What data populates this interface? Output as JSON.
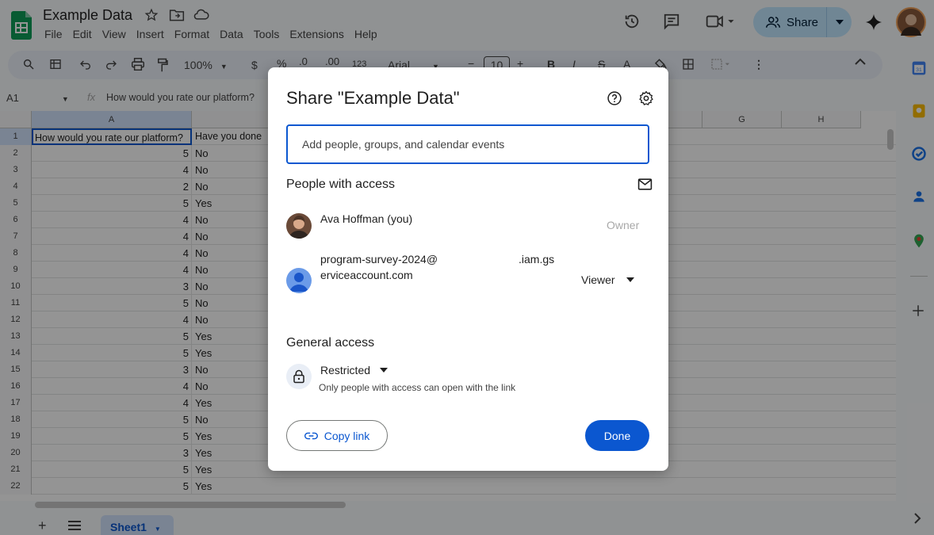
{
  "app": {
    "doc_title": "Example Data",
    "menu": [
      "File",
      "Edit",
      "View",
      "Insert",
      "Format",
      "Data",
      "Tools",
      "Extensions",
      "Help"
    ],
    "share_label": "Share"
  },
  "toolbar": {
    "zoom": "100%",
    "currency": "$",
    "percent": "%",
    "dec_decrease": ".0",
    "dec_increase": ".00",
    "number_format": "123",
    "font": "Arial",
    "font_size": "10"
  },
  "formula_bar": {
    "cell_ref": "A1",
    "content": "How would you rate our platform?"
  },
  "grid": {
    "columns": [
      "A",
      "G",
      "H"
    ],
    "header_a": "How would you rate our platform?",
    "header_b": "Have you done",
    "rows": [
      {
        "n": "2",
        "a": "5",
        "b": "No"
      },
      {
        "n": "3",
        "a": "4",
        "b": "No"
      },
      {
        "n": "4",
        "a": "2",
        "b": "No"
      },
      {
        "n": "5",
        "a": "5",
        "b": "Yes"
      },
      {
        "n": "6",
        "a": "4",
        "b": "No"
      },
      {
        "n": "7",
        "a": "4",
        "b": "No"
      },
      {
        "n": "8",
        "a": "4",
        "b": "No"
      },
      {
        "n": "9",
        "a": "4",
        "b": "No"
      },
      {
        "n": "10",
        "a": "3",
        "b": "No"
      },
      {
        "n": "11",
        "a": "5",
        "b": "No"
      },
      {
        "n": "12",
        "a": "4",
        "b": "No"
      },
      {
        "n": "13",
        "a": "5",
        "b": "Yes"
      },
      {
        "n": "14",
        "a": "5",
        "b": "Yes"
      },
      {
        "n": "15",
        "a": "3",
        "b": "No"
      },
      {
        "n": "16",
        "a": "4",
        "b": "No"
      },
      {
        "n": "17",
        "a": "4",
        "b": "Yes"
      },
      {
        "n": "18",
        "a": "5",
        "b": "No"
      },
      {
        "n": "19",
        "a": "5",
        "b": "Yes"
      },
      {
        "n": "20",
        "a": "3",
        "b": "Yes"
      },
      {
        "n": "21",
        "a": "5",
        "b": "Yes"
      },
      {
        "n": "22",
        "a": "5",
        "b": "Yes"
      }
    ]
  },
  "sheet": {
    "tab": "Sheet1"
  },
  "dialog": {
    "title": "Share \"Example Data\"",
    "input_placeholder": "Add people, groups, and calendar events",
    "people_label": "People with access",
    "owner_name": "Ava Hoffman (you)",
    "owner_role": "Owner",
    "sa_line1_start": "program-survey-2024@",
    "sa_line1_end": ".iam.gs",
    "sa_line2": "erviceaccount.com",
    "sa_role": "Viewer",
    "general_label": "General access",
    "restricted_label": "Restricted",
    "restricted_desc": "Only people with access can open with the link",
    "copy_link": "Copy link",
    "done": "Done"
  },
  "colors": {
    "accent": "#0b57d0",
    "share_bg": "#c2e7ff",
    "sheets_green": "#0f9d58"
  }
}
